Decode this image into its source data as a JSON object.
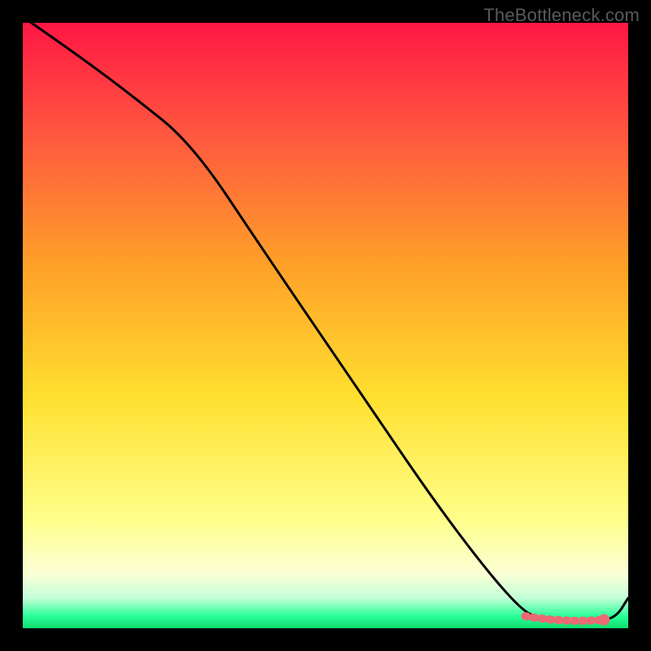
{
  "watermark": "TheBottleneck.com",
  "colors": {
    "gradient_top": "#ff1744",
    "gradient_upper": "#ff5640",
    "gradient_orange": "#ffa028",
    "gradient_yellow": "#ffe030",
    "gradient_lowyellow": "#ffff8a",
    "gradient_cream": "#fbffd6",
    "gradient_mint": "#c4ffd8",
    "gradient_green": "#2bff99",
    "gradient_deepgreen": "#0edb6e",
    "line": "#000000",
    "marker": "#ec6a72"
  },
  "chart_data": {
    "type": "line",
    "title": "",
    "xlabel": "",
    "ylabel": "",
    "xlim": [
      0,
      100
    ],
    "ylim": [
      0,
      100
    ],
    "grid": false,
    "legend": false,
    "series": [
      {
        "name": "bottleneck-curve",
        "x": [
          0,
          10,
          18,
          28,
          40,
          55,
          70,
          82,
          86,
          88,
          90,
          92,
          95,
          98,
          100
        ],
        "values": [
          101,
          94,
          88,
          80,
          62,
          40,
          18,
          3,
          1.5,
          1.2,
          1.0,
          1.0,
          1.2,
          1.8,
          5
        ]
      }
    ],
    "markers": [
      {
        "name": "optimal-range-start",
        "x": 83,
        "y": 2.0
      },
      {
        "name": "optimal-range-end",
        "x": 96,
        "y": 1.4
      }
    ],
    "annotations": []
  }
}
